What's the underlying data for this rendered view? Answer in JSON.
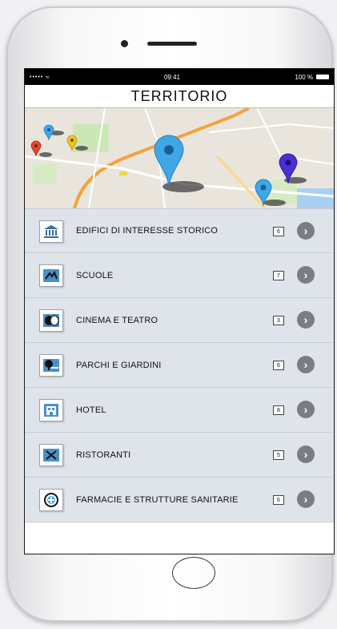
{
  "statusbar": {
    "signal": "•••••",
    "time": "09:41",
    "battery": "100 %"
  },
  "header": {
    "title": "TERRITORIO"
  },
  "categories": [
    {
      "label": "EDIFICI DI INTERESSE STORICO",
      "count": "6",
      "icon": "museum-icon"
    },
    {
      "label": "SCUOLE",
      "count": "7",
      "icon": "school-icon"
    },
    {
      "label": "CINEMA E TEATRO",
      "count": "3",
      "icon": "theater-masks-icon"
    },
    {
      "label": "PARCHI E GIARDINI",
      "count": "6",
      "icon": "park-bench-icon"
    },
    {
      "label": "HOTEL",
      "count": "8",
      "icon": "hotel-icon"
    },
    {
      "label": "RISTORANTI",
      "count": "5",
      "icon": "restaurant-icon"
    },
    {
      "label": "FARMACIE E STRUTTURE SANITARIE",
      "count": "6",
      "icon": "medical-cross-icon"
    }
  ],
  "colors": {
    "list_bg": "#dfe3ea",
    "pin_blue": "#3fa7e8",
    "pin_purple": "#4a2fd6",
    "pin_red": "#e24a2e",
    "pin_yellow": "#f3c41b",
    "road_orange": "#f4a23c",
    "arrow_gray": "#7a7d82"
  }
}
